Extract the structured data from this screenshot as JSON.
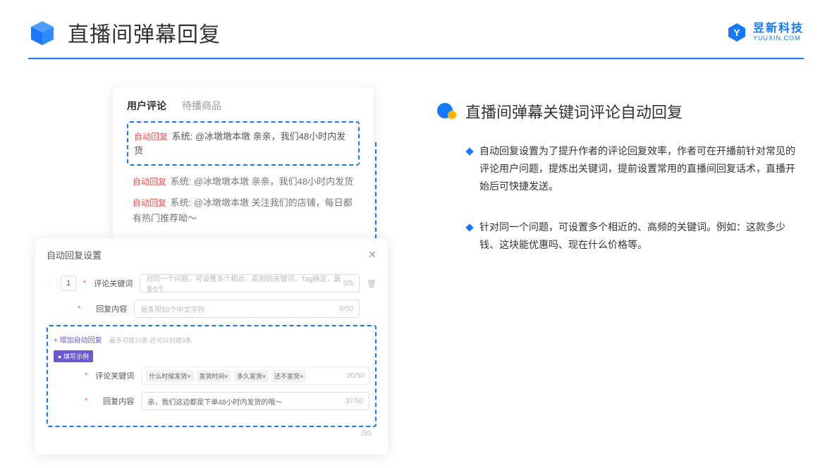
{
  "header": {
    "title": "直播间弹幕回复",
    "brand_cn": "昱新科技",
    "brand_en": "YUUXIN.COM"
  },
  "comments_card": {
    "tabs": [
      "用户评论",
      "待播商品"
    ],
    "active_tab": 0,
    "highlight": {
      "badge": "自动回复",
      "text": "系统: @冰墩墩本墩 亲亲，我们48小时内发货"
    },
    "others": [
      {
        "badge": "自动回复",
        "text": "系统: @冰墩墩本墩 亲亲，我们48小时内发货"
      },
      {
        "badge": "自动回复",
        "text": "系统: @冰墩墩本墩 关注我们的店铺，每日都有热门推荐呦～"
      }
    ]
  },
  "settings_card": {
    "title": "自动回复设置",
    "index": "1",
    "keyword_label": "评论关键词",
    "keyword_placeholder": "对同一个问题，可设置多个相近、高频的关键词，Tag确定，最多5个",
    "keyword_counter": "0/5",
    "reply_label": "回复内容",
    "reply_placeholder": "每条限50个中文字符",
    "reply_counter": "0/50",
    "add_link": "+ 增加自动回复",
    "add_hint": "最多可建10条 还可以创建9条",
    "example_tag": "● 填写示例",
    "ex_keyword_label": "评论关键词",
    "ex_chips": [
      "什么时候发货×",
      "发货时间×",
      "多久发货×",
      "还不发货×"
    ],
    "ex_keyword_counter": "20/50",
    "ex_reply_label": "回复内容",
    "ex_reply_text": "亲，我们这边都是下单48小时内发货的哦～",
    "ex_reply_counter": "37/50",
    "lower_counter": "/50"
  },
  "right": {
    "title": "直播间弹幕关键词评论自动回复",
    "bullets": [
      "自动回复设置为了提升作者的评论回复效率，作者可在开播前针对常见的评论用户问题，提炼出关键词，提前设置常用的直播间回复话术，直播开始后可快捷发送。",
      "针对同一个问题，可设置多个相近的、高频的关键词。例如：这款多少钱、这块能优惠吗、现在什么价格等。"
    ]
  }
}
